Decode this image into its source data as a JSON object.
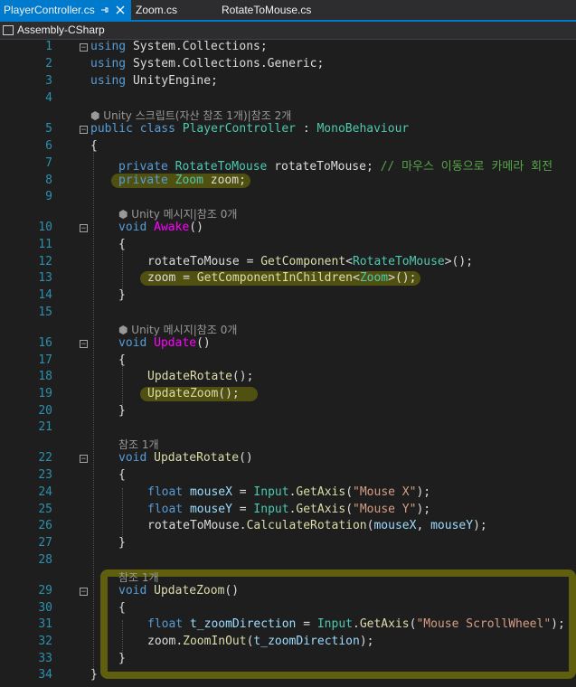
{
  "tabs": [
    {
      "label": "PlayerController.cs",
      "active": true
    },
    {
      "label": "Zoom.cs",
      "active": false
    },
    {
      "label": "RotateToMouse.cs",
      "active": false
    }
  ],
  "tab_icons": {
    "pin": "pin-icon",
    "close": "close-icon"
  },
  "navbar": {
    "project": "Assembly-CSharp",
    "icon": "csharp-project-icon"
  },
  "colors": {
    "accent": "#007acc",
    "keyword": "#569cd6",
    "type": "#4ec9b0",
    "method": "#dcdcaa",
    "variable": "#9cdcfe",
    "string": "#d69d85",
    "comment": "#57a64a",
    "line_number": "#2b91af",
    "highlight": "#969600"
  },
  "line_numbers": [
    "1",
    "2",
    "3",
    "4",
    "5",
    "6",
    "7",
    "8",
    "9",
    "10",
    "11",
    "12",
    "13",
    "14",
    "15",
    "16",
    "17",
    "18",
    "19",
    "20",
    "21",
    "22",
    "23",
    "24",
    "25",
    "26",
    "27",
    "28",
    "29",
    "30",
    "31",
    "32",
    "33",
    "34"
  ],
  "lens": {
    "class_refs": "Unity 스크립트(자산 참조 1개)|참조 2개",
    "awake_refs": "Unity 메시지|참조 0개",
    "update_refs": "Unity 메시지|참조 0개",
    "update_rotate_refs": "참조 1개",
    "update_zoom_refs": "참조 1개"
  },
  "code": {
    "l1_kw": "using",
    "l1_ns": " System.Collections;",
    "l2_kw": "using",
    "l2_ns": " System.Collections.Generic;",
    "l3_kw": "using",
    "l3_ns": " UnityEngine;",
    "l5_kw1": "public",
    "l5_kw2": "class",
    "l5_name": "PlayerController",
    "l5_colon": " : ",
    "l5_base": "MonoBehaviour",
    "l6": "{",
    "l7_kw": "private",
    "l7_type": "RotateToMouse",
    "l7_var": " rotateToMouse;",
    "l7_comment": "// 마우스 이동으로 카메라 회전",
    "l8_kw": "private",
    "l8_type": "Zoom",
    "l8_var": " zoom;",
    "l10_kw": "void",
    "l10_name": "Awake",
    "l10_paren": "()",
    "l11": "{",
    "l12_var": "rotateToMouse",
    "l12_eq": " = ",
    "l12_fn": "GetComponent",
    "l12_lt": "<",
    "l12_type": "RotateToMouse",
    "l12_end": ">();",
    "l13_var": "zoom",
    "l13_eq": " = ",
    "l13_fn": "GetComponentInChildren",
    "l13_lt": "<",
    "l13_type": "Zoom",
    "l13_end": ">();",
    "l14": "}",
    "l16_kw": "void",
    "l16_name": "Update",
    "l16_paren": "()",
    "l17": "{",
    "l18_fn": "UpdateRotate",
    "l18_end": "();",
    "l19_fn": "UpdateZoom",
    "l19_end": "();",
    "l20": "}",
    "l22_kw": "void",
    "l22_name": "UpdateRotate",
    "l22_paren": "()",
    "l23": "{",
    "l24_kw": "float",
    "l24_var": "mouseX",
    "l24_eq": " = ",
    "l24_cls": "Input",
    "l24_dot": ".",
    "l24_fn": "GetAxis",
    "l24_op": "(",
    "l24_str": "\"Mouse X\"",
    "l24_end": ");",
    "l25_kw": "float",
    "l25_var": "mouseY",
    "l25_eq": " = ",
    "l25_cls": "Input",
    "l25_dot": ".",
    "l25_fn": "GetAxis",
    "l25_op": "(",
    "l25_str": "\"Mouse Y\"",
    "l25_end": ");",
    "l26_obj": "rotateToMouse",
    "l26_dot": ".",
    "l26_fn": "CalculateRotation",
    "l26_op": "(",
    "l26_a1": "mouseX",
    "l26_comma": ", ",
    "l26_a2": "mouseY",
    "l26_end": ");",
    "l27": "}",
    "l29_kw": "void",
    "l29_name": "UpdateZoom",
    "l29_paren": "()",
    "l30": "{",
    "l31_kw": "float",
    "l31_var": "t_zoomDirection",
    "l31_eq": " = ",
    "l31_cls": "Input",
    "l31_dot": ".",
    "l31_fn": "GetAxis",
    "l31_op": "(",
    "l31_str": "\"Mouse ScrollWheel\"",
    "l31_end": ");",
    "l32_obj": "zoom",
    "l32_dot": ".",
    "l32_fn": "ZoomInOut",
    "l32_op": "(",
    "l32_arg": "t_zoomDirection",
    "l32_end": ");",
    "l33": "}",
    "l34": "}"
  }
}
